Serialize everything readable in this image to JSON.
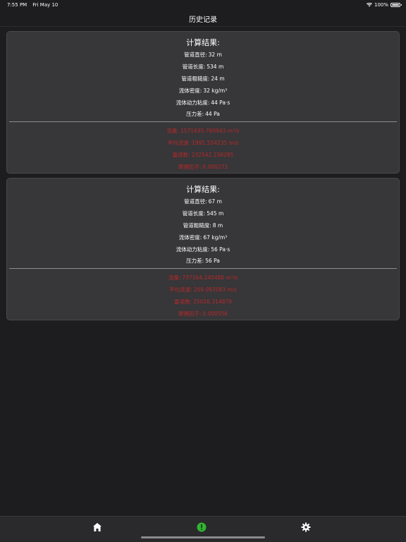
{
  "status_bar": {
    "time": "7:55 PM",
    "date": "Fri May 10",
    "battery": "100%"
  },
  "nav": {
    "title": "历史记录"
  },
  "history": [
    {
      "title": "计算结果:",
      "rows": [
        {
          "label": "管道直径:",
          "value": "32 m"
        },
        {
          "label": "管道长度:",
          "value": "534 m"
        },
        {
          "label": "管道粗糙度:",
          "value": "24 m"
        },
        {
          "label": "流体密度:",
          "value": "32 kg/m³"
        },
        {
          "label": "流体动力粘度:",
          "value": "44 Pa·s"
        },
        {
          "label": "压力差:",
          "value": "44 Pa"
        }
      ],
      "results": [
        {
          "label": "流量:",
          "value": "1571635.760943 m³/s"
        },
        {
          "label": "平均流速:",
          "value": "1991.554235 m/s"
        },
        {
          "label": "雷诺数:",
          "value": "232542.236285"
        },
        {
          "label": "摩擦因子:",
          "value": "0.000273"
        }
      ]
    },
    {
      "title": "计算结果:",
      "rows": [
        {
          "label": "管道直径:",
          "value": "67 m"
        },
        {
          "label": "管道长度:",
          "value": "545 m"
        },
        {
          "label": "管道粗糙度:",
          "value": "8 m"
        },
        {
          "label": "流体密度:",
          "value": "67 kg/m³"
        },
        {
          "label": "流体动力粘度:",
          "value": "56 Pa·s"
        },
        {
          "label": "压力差:",
          "value": "56 Pa"
        }
      ],
      "results": [
        {
          "label": "流量:",
          "value": "737164.245480 m³/s"
        },
        {
          "label": "平均流速:",
          "value": "209.093583 m/s"
        },
        {
          "label": "雷诺数:",
          "value": "25016.314879"
        },
        {
          "label": "摩擦因子:",
          "value": "0.000556"
        }
      ]
    }
  ],
  "tabs": [
    {
      "name": "home-icon"
    },
    {
      "name": "calculator-icon",
      "color": "#2fb52f"
    },
    {
      "name": "gear-icon"
    }
  ]
}
